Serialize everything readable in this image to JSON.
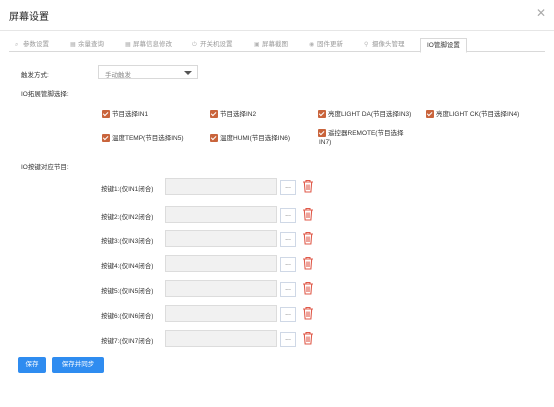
{
  "dialog": {
    "title": "屏幕设置",
    "close_icon": "close-icon"
  },
  "tabs": [
    {
      "label": "参数设置",
      "icon": "search-icon",
      "active": false
    },
    {
      "label": "余量查询",
      "icon": "grid-icon",
      "active": false
    },
    {
      "label": "屏幕信息修改",
      "icon": "grid-icon",
      "active": false
    },
    {
      "label": "开关机设置",
      "icon": "power-icon",
      "active": false
    },
    {
      "label": "屏幕截图",
      "icon": "image-icon",
      "active": false
    },
    {
      "label": "固件更新",
      "icon": "disk-icon",
      "active": false
    },
    {
      "label": "摄像头管理",
      "icon": "location-icon",
      "active": false
    },
    {
      "label": "IO管脚设置",
      "icon": "",
      "active": true
    }
  ],
  "trigger": {
    "label": "触发方式:",
    "value": "手动触发"
  },
  "io_section": {
    "label": "IO拓展管脚选择:"
  },
  "io_options": [
    {
      "label": "节目选择IN1",
      "checked": true
    },
    {
      "label": "节目选择IN2",
      "checked": true
    },
    {
      "label": "亮度LIGHT DA(节目选择IN3)",
      "checked": true
    },
    {
      "label": "亮度LIGHT CK(节目选择IN4)",
      "checked": true
    },
    {
      "label": "温度TEMP(节目选择IN5)",
      "checked": true
    },
    {
      "label": "温度HUMI(节目选择IN6)",
      "checked": true
    },
    {
      "label": "遥控器REMOTE(节目选择",
      "label_line2": "IN7)",
      "checked": true
    }
  ],
  "keys_section": {
    "label": "IO按键对应节目:"
  },
  "keys": [
    {
      "label": "按键1:(仅IN1闭合)",
      "value": "",
      "browse": "..."
    },
    {
      "label": "按键2:(仅IN2闭合)",
      "value": "",
      "browse": "..."
    },
    {
      "label": "按键3:(仅IN3闭合)",
      "value": "",
      "browse": "..."
    },
    {
      "label": "按键4:(仅IN4闭合)",
      "value": "",
      "browse": "..."
    },
    {
      "label": "按键5:(仅IN5闭合)",
      "value": "",
      "browse": "..."
    },
    {
      "label": "按键6:(仅IN6闭合)",
      "value": "",
      "browse": "..."
    },
    {
      "label": "按键7:(仅IN7闭合)",
      "value": "",
      "browse": "..."
    }
  ],
  "actions": {
    "save": "保存",
    "save_sync": "保存并同步"
  },
  "colors": {
    "accent": "#2f8cf0",
    "checkbox": "#c9643c",
    "delete": "#e05a4a"
  }
}
